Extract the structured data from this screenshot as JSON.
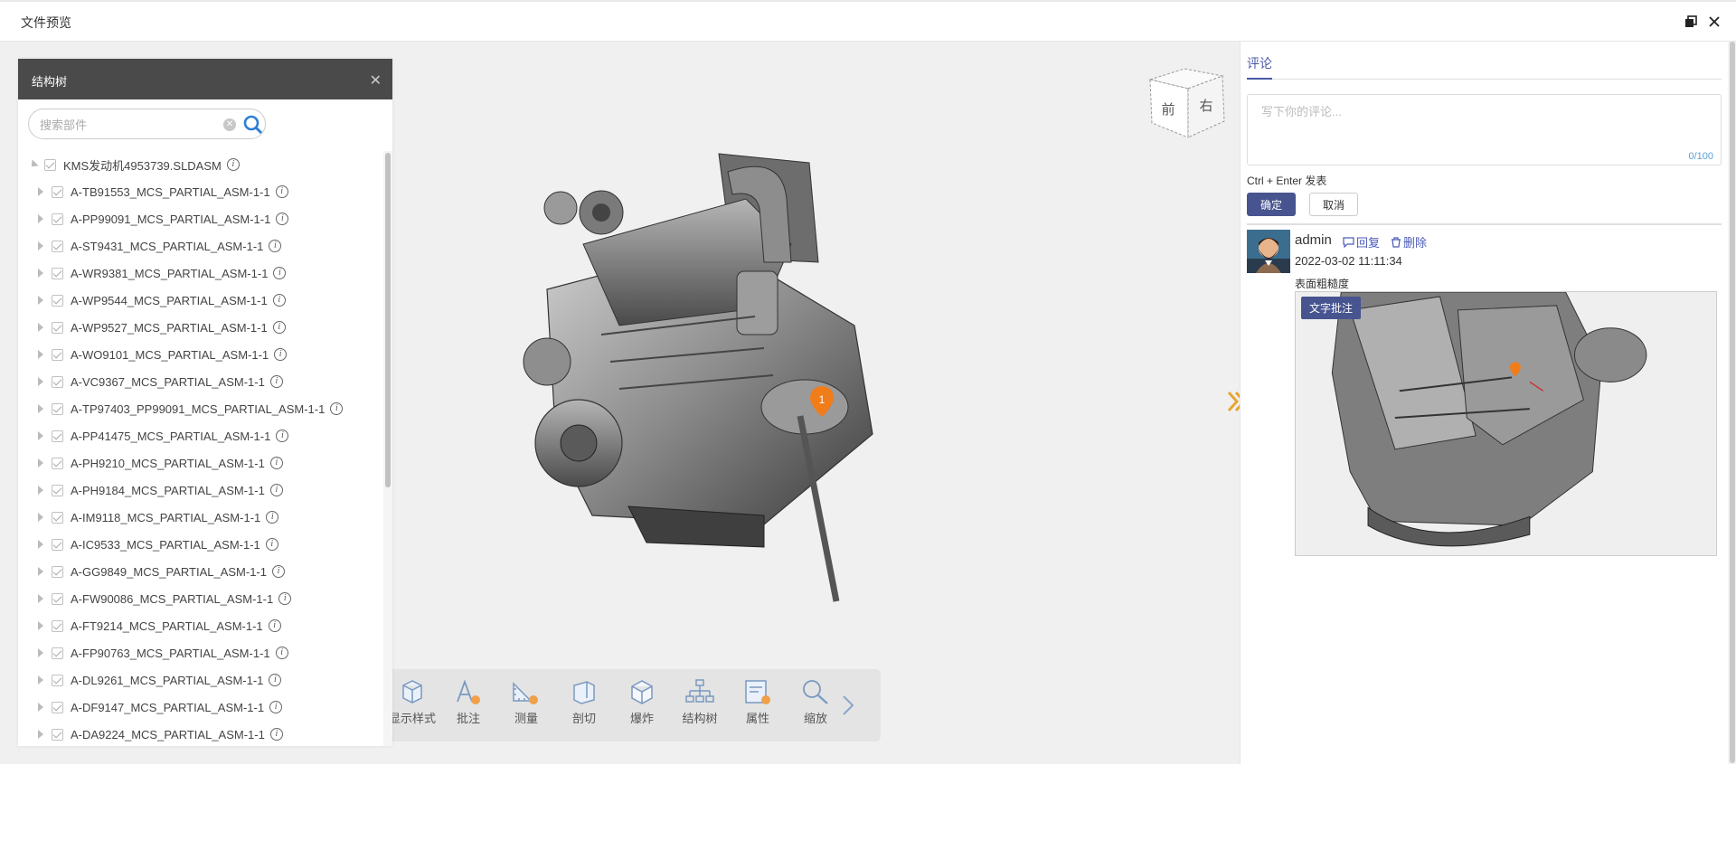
{
  "window": {
    "title": "文件预览"
  },
  "tree": {
    "title": "结构树",
    "search_placeholder": "搜索部件",
    "root": "KMS发动机4953739.SLDASM",
    "items": [
      "A-TB91553_MCS_PARTIAL_ASM-1-1",
      "A-PP99091_MCS_PARTIAL_ASM-1-1",
      "A-ST9431_MCS_PARTIAL_ASM-1-1",
      "A-WR9381_MCS_PARTIAL_ASM-1-1",
      "A-WP9544_MCS_PARTIAL_ASM-1-1",
      "A-WP9527_MCS_PARTIAL_ASM-1-1",
      "A-WO9101_MCS_PARTIAL_ASM-1-1",
      "A-VC9367_MCS_PARTIAL_ASM-1-1",
      "A-TP97403_PP99091_MCS_PARTIAL_ASM-1-1",
      "A-PP41475_MCS_PARTIAL_ASM-1-1",
      "A-PH9210_MCS_PARTIAL_ASM-1-1",
      "A-PH9184_MCS_PARTIAL_ASM-1-1",
      "A-IM9118_MCS_PARTIAL_ASM-1-1",
      "A-IC9533_MCS_PARTIAL_ASM-1-1",
      "A-GG9849_MCS_PARTIAL_ASM-1-1",
      "A-FW90086_MCS_PARTIAL_ASM-1-1",
      "A-FT9214_MCS_PARTIAL_ASM-1-1",
      "A-FP90763_MCS_PARTIAL_ASM-1-1",
      "A-DL9261_MCS_PARTIAL_ASM-1-1",
      "A-DF9147_MCS_PARTIAL_ASM-1-1",
      "A-DA9224_MCS_PARTIAL_ASM-1-1"
    ]
  },
  "cube": {
    "front": "前",
    "right": "右"
  },
  "marker": {
    "label": "1"
  },
  "toolbar": {
    "items": [
      {
        "label": "显示样式",
        "icon": "display-style-icon"
      },
      {
        "label": "批注",
        "icon": "annotate-icon"
      },
      {
        "label": "测量",
        "icon": "measure-icon"
      },
      {
        "label": "剖切",
        "icon": "section-icon"
      },
      {
        "label": "爆炸",
        "icon": "explode-icon"
      },
      {
        "label": "结构树",
        "icon": "structure-tree-icon"
      },
      {
        "label": "属性",
        "icon": "properties-icon"
      },
      {
        "label": "缩放",
        "icon": "zoom-icon"
      }
    ]
  },
  "comments": {
    "tab": "评论",
    "placeholder": "写下你的评论...",
    "count": "0/100",
    "hint": "Ctrl + Enter 发表",
    "ok": "确定",
    "cancel": "取消",
    "entry": {
      "user": "admin",
      "reply": "回复",
      "delete": "删除",
      "time": "2022-03-02 11:11:34",
      "text": "表面粗糙度",
      "badge": "文字批注"
    }
  },
  "colors": {
    "accent": "#47548f",
    "marker": "#f07c1a",
    "arrow": "#e8a531"
  }
}
